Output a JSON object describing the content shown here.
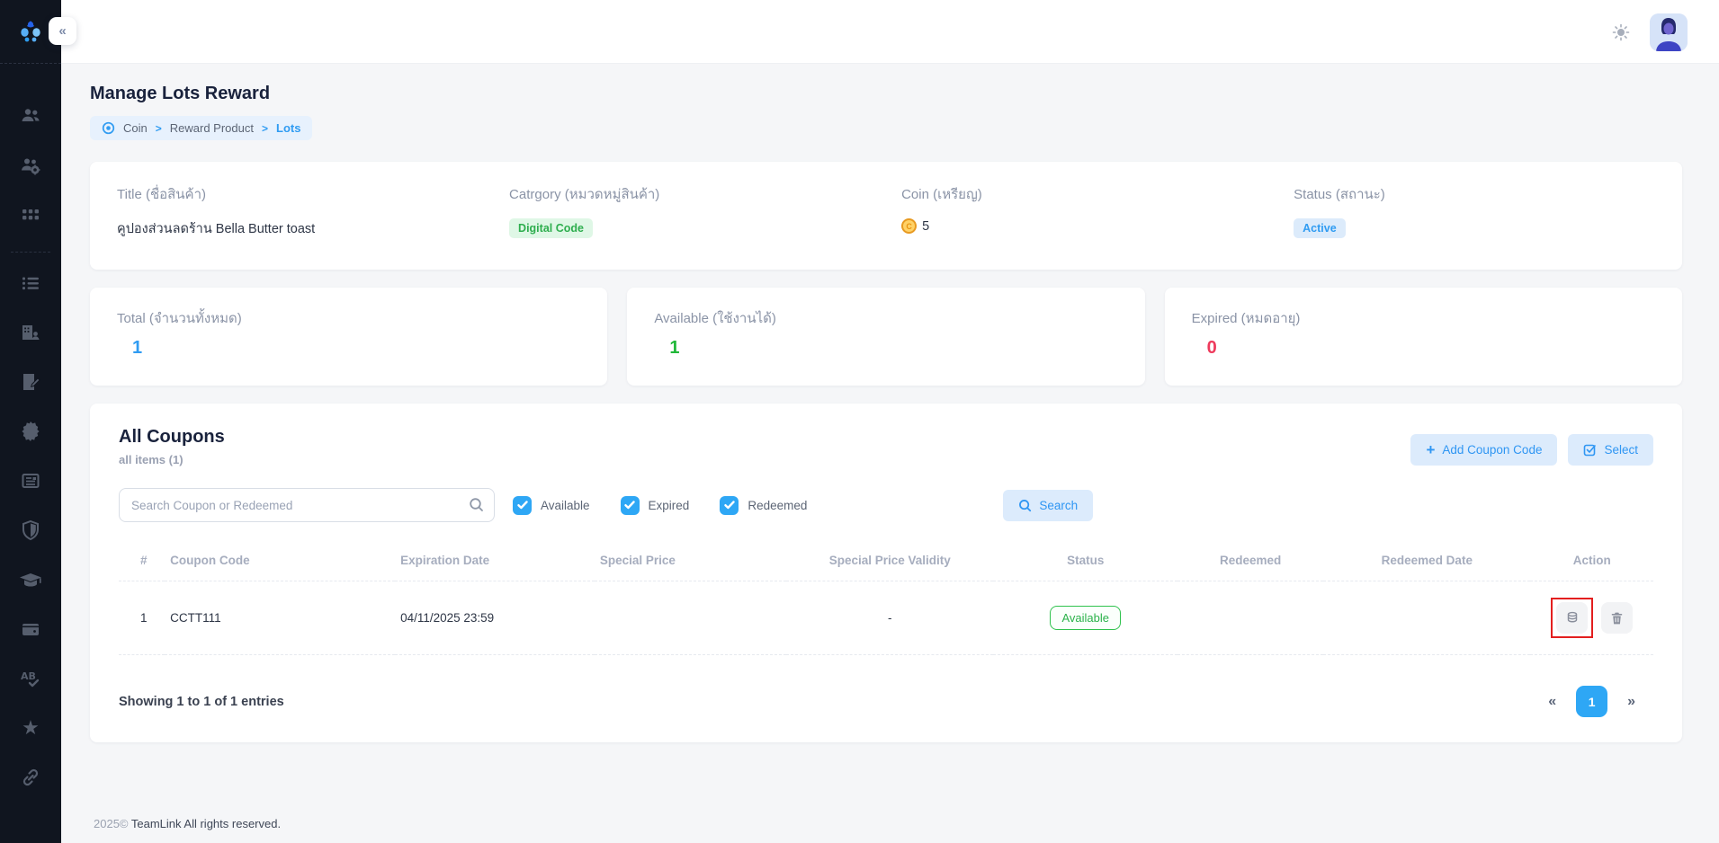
{
  "colors": {
    "primary_blue": "#309CF2",
    "light_blue_bg": "#E7F1FD",
    "green": "#2EAE4E",
    "red": "#EE3A5C",
    "coin_orange": "#E89A21",
    "highlight_red": "#E31F1F",
    "sidebar_bg": "#10151F"
  },
  "sidebar": {
    "logo_icon": "teamlink-logo",
    "icons": [
      "team-icon",
      "team-settings-icon",
      "apps-grid-icon",
      "list-icon",
      "organization-icon",
      "document-edit-icon",
      "badge-icon",
      "news-icon",
      "shield-icon",
      "education-icon",
      "wallet-icon",
      "spellcheck-icon",
      "star-icon",
      "link-icon"
    ]
  },
  "header": {
    "collapse_glyph": "«",
    "theme_icon": "sun-icon",
    "avatar_icon": "user-avatar"
  },
  "page": {
    "title": "Manage Lots Reward",
    "breadcrumb": {
      "root": "Coin",
      "middle": "Reward Product",
      "current": "Lots",
      "separator": ">"
    }
  },
  "details": {
    "title_label": "Title (ชื่อสินค้า)",
    "title_value": "คูปองส่วนลดร้าน Bella Butter toast",
    "category_label": "Catrgory (หมวดหมู่สินค้า)",
    "category_value": "Digital Code",
    "coin_label": "Coin (เหรียญ)",
    "coin_glyph": "C",
    "coin_value": "5",
    "status_label": "Status (สถานะ)",
    "status_value": "Active"
  },
  "stats": [
    {
      "label": "Total (จำนวนทั้งหมด)",
      "value": "1",
      "color": "blue"
    },
    {
      "label": "Available (ใช้งานได้)",
      "value": "1",
      "color": "green"
    },
    {
      "label": "Expired (หมดอายุ)",
      "value": "0",
      "color": "red"
    }
  ],
  "coupons": {
    "title": "All Coupons",
    "subtitle": "all items (1)",
    "add_button": "Add Coupon Code",
    "add_glyph": "+",
    "select_button": "Select",
    "search_placeholder": "Search Coupon or Redeemed",
    "filters": [
      {
        "label": "Available",
        "checked": true
      },
      {
        "label": "Expired",
        "checked": true
      },
      {
        "label": "Redeemed",
        "checked": true
      }
    ],
    "search_button": "Search",
    "table": {
      "headers": [
        "#",
        "Coupon Code",
        "Expiration Date",
        "Special Price",
        "Special Price Validity",
        "Status",
        "Redeemed",
        "Redeemed Date",
        "Action"
      ],
      "rows": [
        {
          "index": "1",
          "coupon_code": "CCTT111",
          "expiration_date": "04/11/2025 23:59",
          "special_price": "",
          "special_price_validity": "-",
          "status": "Available",
          "redeemed": "",
          "redeemed_date": "",
          "action_highlighted": true
        }
      ]
    },
    "showing": "Showing 1 to 1 of 1 entries",
    "pagination": {
      "prev": "«",
      "current_page": "1",
      "next": "»"
    }
  },
  "footer": {
    "copyright": "2025© ",
    "text": "TeamLink All rights reserved."
  }
}
